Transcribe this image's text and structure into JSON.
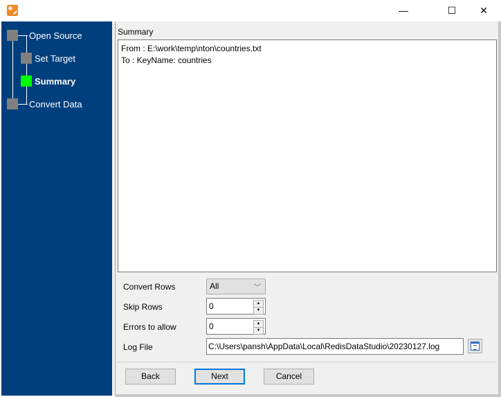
{
  "window": {
    "title": "",
    "controls": {
      "minimize": "—",
      "maximize": "☐",
      "close": "✕"
    }
  },
  "sidebar": {
    "steps": [
      {
        "label": "Open Source",
        "state": "pending"
      },
      {
        "label": "Set Target",
        "state": "pending"
      },
      {
        "label": "Summary",
        "state": "active"
      },
      {
        "label": "Convert Data",
        "state": "pending"
      }
    ],
    "colors": {
      "background": "#003f7d",
      "active": "#00ff00",
      "pending": "#808080"
    }
  },
  "summary": {
    "label": "Summary",
    "lines": [
      "From : E:\\work\\temp\\nton\\countries.txt",
      "To : KeyName: countries"
    ]
  },
  "form": {
    "convert_rows": {
      "label": "Convert Rows",
      "value": "All"
    },
    "skip_rows": {
      "label": "Skip Rows",
      "value": "0"
    },
    "errors_to_allow": {
      "label": "Errors to allow",
      "value": "0"
    },
    "log_file": {
      "label": "Log File",
      "value": "C:\\Users\\pansh\\AppData\\Local\\RedisDataStudio\\20230127.log"
    }
  },
  "buttons": {
    "back": "Back",
    "next": "Next",
    "cancel": "Cancel"
  },
  "glyphs": {
    "chevron": "﹀",
    "up": "▲",
    "down": "▼"
  }
}
